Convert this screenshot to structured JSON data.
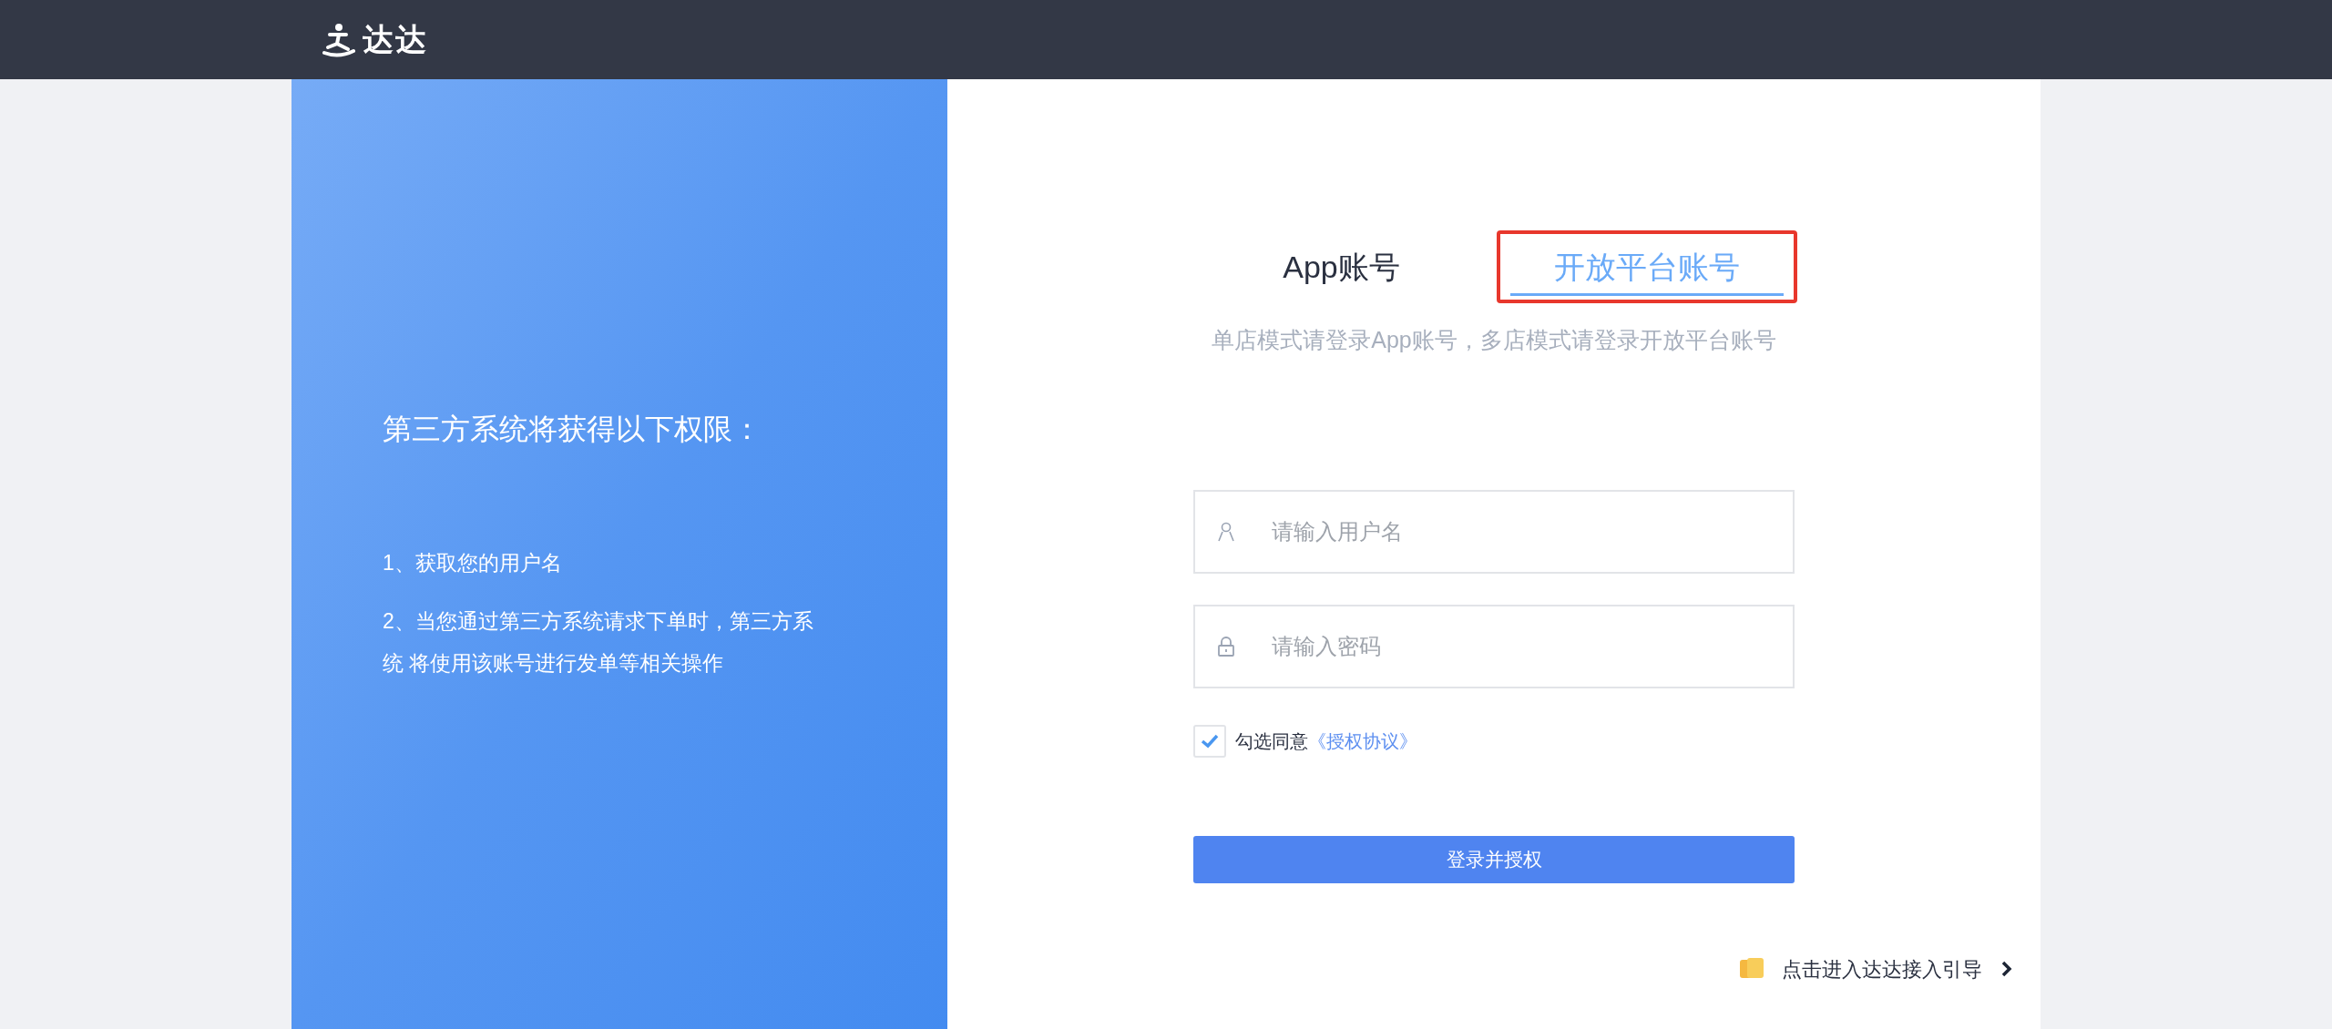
{
  "header": {
    "logo_text": "达达"
  },
  "info_panel": {
    "heading": "第三方系统将获得以下权限：",
    "items": [
      "1、获取您的用户名",
      "2、当您通过第三方系统请求下单时，第三方系统 将使用该账号进行发单等相关操作"
    ]
  },
  "tabs": [
    {
      "label": "App账号",
      "selected": false
    },
    {
      "label": "开放平台账号",
      "selected": true
    }
  ],
  "subtitle": "单店模式请登录App账号，多店模式请登录开放平台账号",
  "fields": [
    {
      "kind": "user",
      "placeholder": "请输入用户名"
    },
    {
      "kind": "password",
      "placeholder": "请输入密码"
    }
  ],
  "agreement": {
    "checked": true,
    "text": "勾选同意",
    "link": "《授权协议》"
  },
  "submit_button": "登录并授权",
  "guide_link": "点击进入达达接入引导"
}
